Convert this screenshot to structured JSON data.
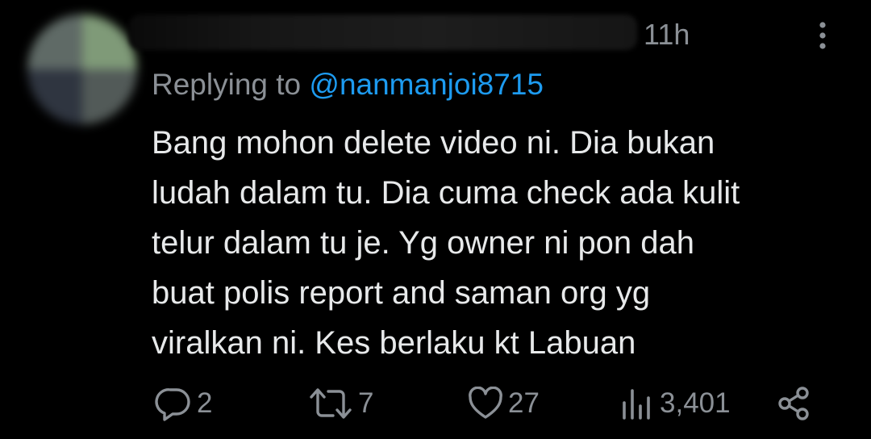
{
  "tweet": {
    "timestamp": "11h",
    "replying_prefix": "Replying to ",
    "replying_handle": "@nanmanjoi8715",
    "lines": [
      "Bang mohon delete video ni. Dia bukan",
      "ludah dalam tu. Dia cuma check ada kulit",
      "telur dalam tu je. Yg owner ni pon dah",
      "buat polis report and saman org yg",
      "viralkan ni. Kes berlaku kt Labuan"
    ]
  },
  "actions": {
    "reply_count": "2",
    "retweet_count": "7",
    "like_count": "27",
    "view_count": "3,401"
  },
  "icons": {
    "more": "more-vertical-icon",
    "reply": "reply-icon",
    "retweet": "retweet-icon",
    "like": "heart-icon",
    "views": "views-icon",
    "share": "share-icon"
  },
  "colors": {
    "background": "#000000",
    "text": "#e7e9ea",
    "muted": "#8b9096",
    "link": "#1d9bf0"
  }
}
